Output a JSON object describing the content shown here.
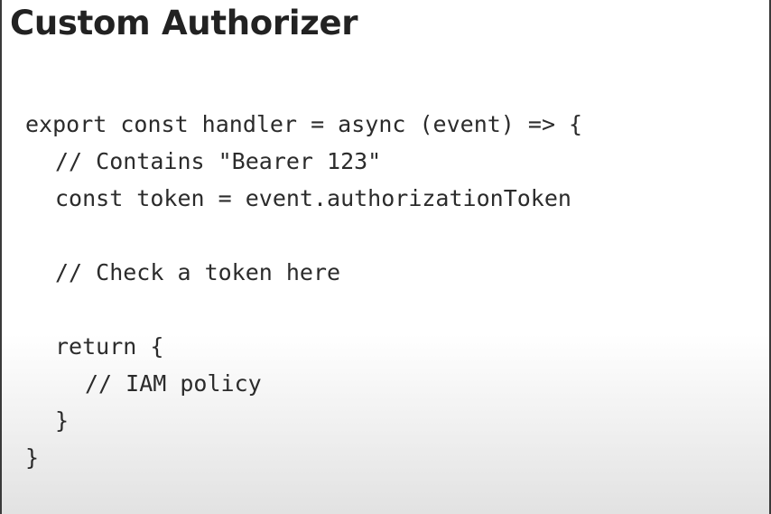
{
  "slide": {
    "title": "Custom Authorizer",
    "code_lines": [
      {
        "text": "export const handler = async (event) => {",
        "indent": 0
      },
      {
        "text": "// Contains \"Bearer 123\"",
        "indent": 1
      },
      {
        "text": "const token = event.authorizationToken",
        "indent": 1
      },
      {
        "text": "",
        "indent": 0
      },
      {
        "text": "// Check a token here",
        "indent": 1
      },
      {
        "text": "",
        "indent": 0
      },
      {
        "text": "return {",
        "indent": 1
      },
      {
        "text": "// IAM policy",
        "indent": 2
      },
      {
        "text": "}",
        "indent": 1
      },
      {
        "text": "}",
        "indent": 0
      }
    ]
  }
}
